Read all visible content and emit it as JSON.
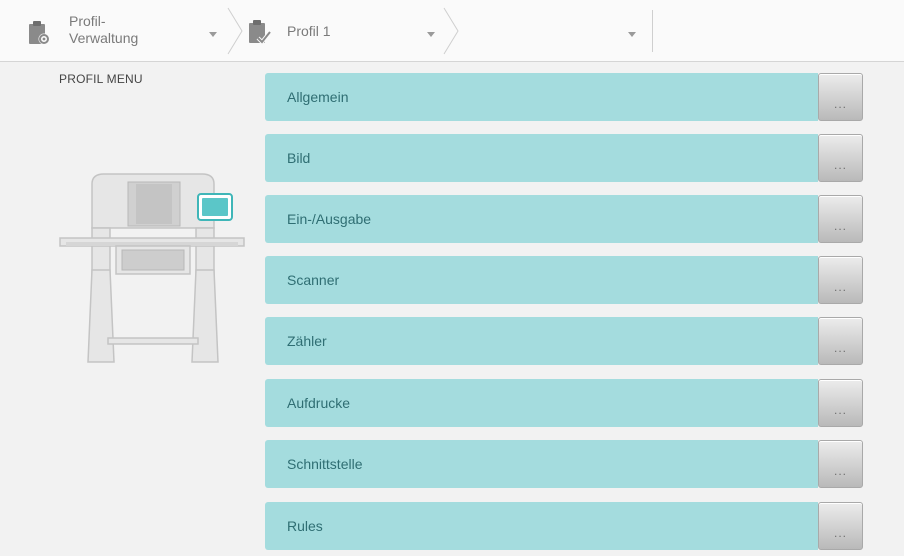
{
  "breadcrumb": {
    "items": [
      {
        "label_line1": "Profil-",
        "label_line2": "Verwaltung",
        "icon": "profile-settings-icon"
      },
      {
        "label": "Profil 1",
        "icon": "profile-check-icon"
      },
      {
        "label": ""
      }
    ]
  },
  "sidebar": {
    "title": "PROFIL MENU",
    "illustration": "scanner-device-illustration"
  },
  "menu": {
    "more_label": "...",
    "items": [
      {
        "label": "Allgemein"
      },
      {
        "label": "Bild"
      },
      {
        "label": "Ein-/Ausgabe"
      },
      {
        "label": "Scanner"
      },
      {
        "label": "Zähler"
      },
      {
        "label": "Aufdrucke"
      },
      {
        "label": "Schnittstelle"
      },
      {
        "label": "Rules"
      }
    ]
  },
  "colors": {
    "row_bg": "#a4dcde",
    "row_text": "#2f6e73",
    "accent": "#3fb6b8"
  }
}
